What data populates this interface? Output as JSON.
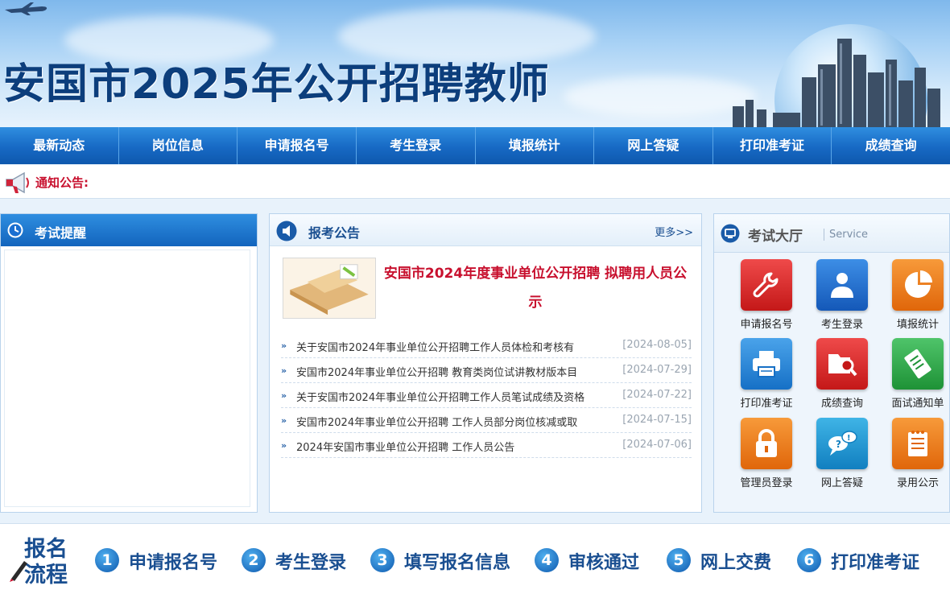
{
  "banner": {
    "title": "安国市2025年公开招聘教师"
  },
  "nav": {
    "items": [
      "最新动态",
      "岗位信息",
      "申请报名号",
      "考生登录",
      "填报统计",
      "网上答疑",
      "打印准考证",
      "成绩查询"
    ]
  },
  "notice": {
    "label": "通知公告:"
  },
  "left_panel": {
    "title": "考试提醒"
  },
  "mid_panel": {
    "title": "报考公告",
    "more": "更多>>",
    "feature_title": "安国市2024年度事业单位公开招聘 拟聘用人员公示",
    "news": [
      {
        "title": "关于安国市2024年事业单位公开招聘工作人员体检和考核有",
        "date": "[2024-08-05]"
      },
      {
        "title": "安国市2024年事业单位公开招聘 教育类岗位试讲教材版本目",
        "date": "[2024-07-29]"
      },
      {
        "title": "关于安国市2024年事业单位公开招聘工作人员笔试成绩及资格",
        "date": "[2024-07-22]"
      },
      {
        "title": "安国市2024年事业单位公开招聘 工作人员部分岗位核减或取",
        "date": "[2024-07-15]"
      },
      {
        "title": "2024年安国市事业单位公开招聘 工作人员公告",
        "date": "[2024-07-06]"
      }
    ]
  },
  "right_panel": {
    "title": "考试大厅",
    "subtitle": "Service",
    "services": [
      {
        "label": "申请报名号",
        "icon": "wrench-icon",
        "color": "#d42a2a"
      },
      {
        "label": "考生登录",
        "icon": "user-icon",
        "color": "#1a6fd1"
      },
      {
        "label": "填报统计",
        "icon": "pie-chart-icon",
        "color": "#ee7a14"
      },
      {
        "label": "打印准考证",
        "icon": "printer-icon",
        "color": "#1f86d8"
      },
      {
        "label": "成绩查询",
        "icon": "search-folder-icon",
        "color": "#d42a2a"
      },
      {
        "label": "面试通知单",
        "icon": "document-icon",
        "color": "#2ea84a"
      },
      {
        "label": "管理员登录",
        "icon": "lock-icon",
        "color": "#ee7a14"
      },
      {
        "label": "网上答疑",
        "icon": "chat-bubbles-icon",
        "color": "#1a9ad6"
      },
      {
        "label": "录用公示",
        "icon": "notepad-icon",
        "color": "#ee7a14"
      }
    ]
  },
  "process": {
    "label_line1": "报名",
    "label_line2": "流程",
    "steps": [
      {
        "num": "1",
        "label": "申请报名号"
      },
      {
        "num": "2",
        "label": "考生登录"
      },
      {
        "num": "3",
        "label": "填写报名信息"
      },
      {
        "num": "4",
        "label": "审核通过"
      },
      {
        "num": "5",
        "label": "网上交费"
      },
      {
        "num": "6",
        "label": "打印准考证"
      }
    ]
  }
}
